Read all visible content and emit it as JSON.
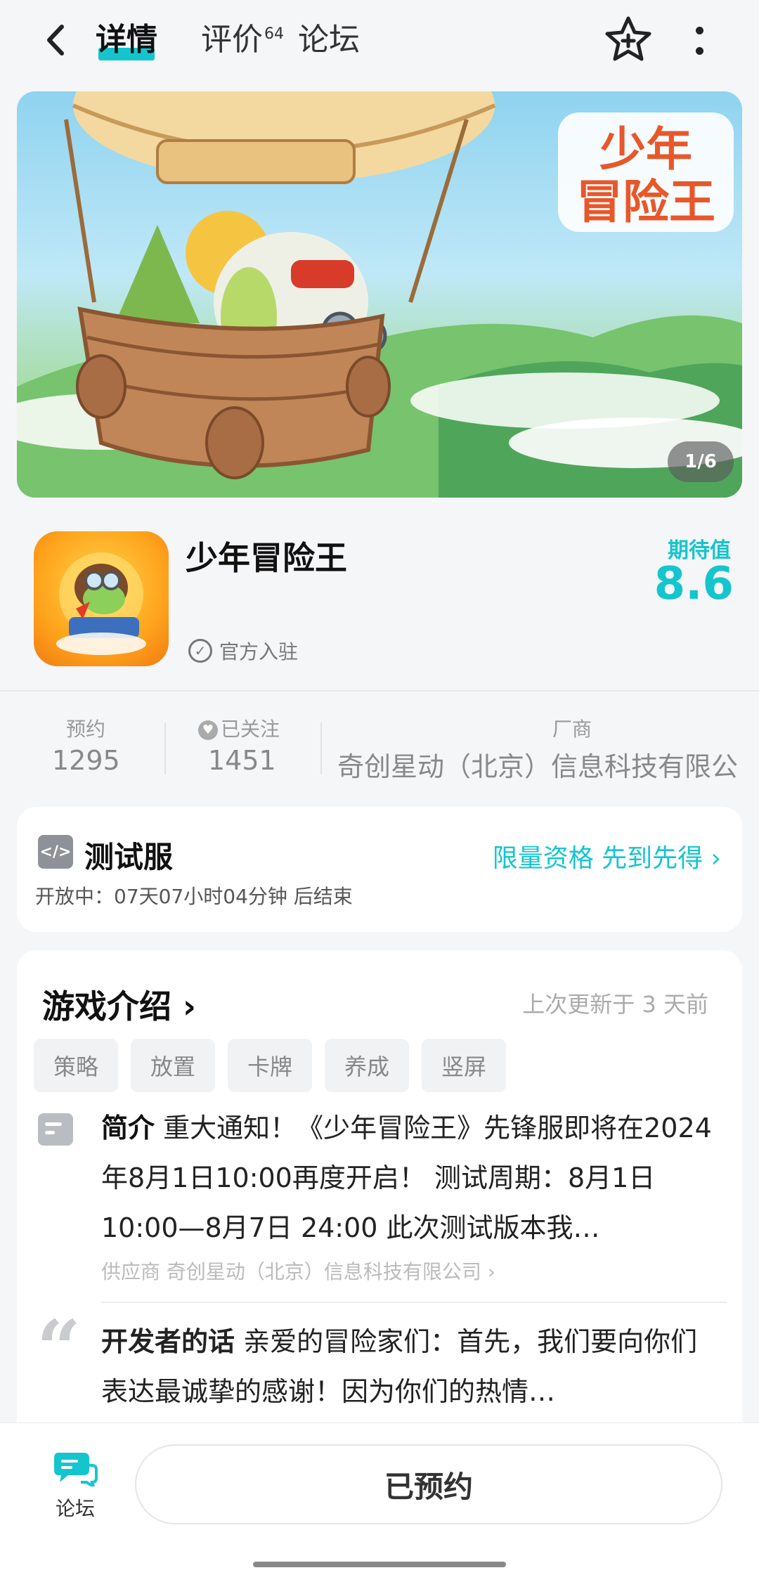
{
  "header": {
    "tabs": [
      {
        "label": "详情",
        "active": true
      },
      {
        "label": "评价",
        "badge": "64"
      },
      {
        "label": "论坛"
      }
    ],
    "accent_color": "#15c5ce"
  },
  "banner": {
    "logo_text": "少年冒险王",
    "indicator": "1/6"
  },
  "app": {
    "name": "少年冒险王",
    "official": "官方入驻",
    "expect_label": "期待值",
    "expect_value": "8.6"
  },
  "stats": [
    {
      "label": "预约",
      "value": "1295"
    },
    {
      "label": "已关注",
      "value": "1451"
    },
    {
      "label": "厂商",
      "value": "奇创星动（北京）信息科技有限公"
    }
  ],
  "test_server": {
    "title": "测试服",
    "link": "限量资格 先到先得 ›",
    "subtitle": "开放中：07天07小时04分钟 后结束"
  },
  "intro": {
    "title": "游戏介绍 ›",
    "updated": "上次更新于 3 天前",
    "tags": [
      "策略",
      "放置",
      "卡牌",
      "养成",
      "竖屏"
    ],
    "brief_label": "简介",
    "brief_text": " 重大通知！《少年冒险王》先锋服即将在2024年8月1日10:00再度开启！ 测试周期：8月1日10:00—8月7日 24:00 此次测试版本我…",
    "supplier": "供应商 奇创星动（北京）信息科技有限公司 ›",
    "dev_label": "开发者的话",
    "dev_text": " 亲爱的冒险家们：首先，我们要向你们表达最诚挚的感谢！因为你们的热情…"
  },
  "bottom": {
    "forum_label": "论坛",
    "reserved_label": "已预约"
  }
}
